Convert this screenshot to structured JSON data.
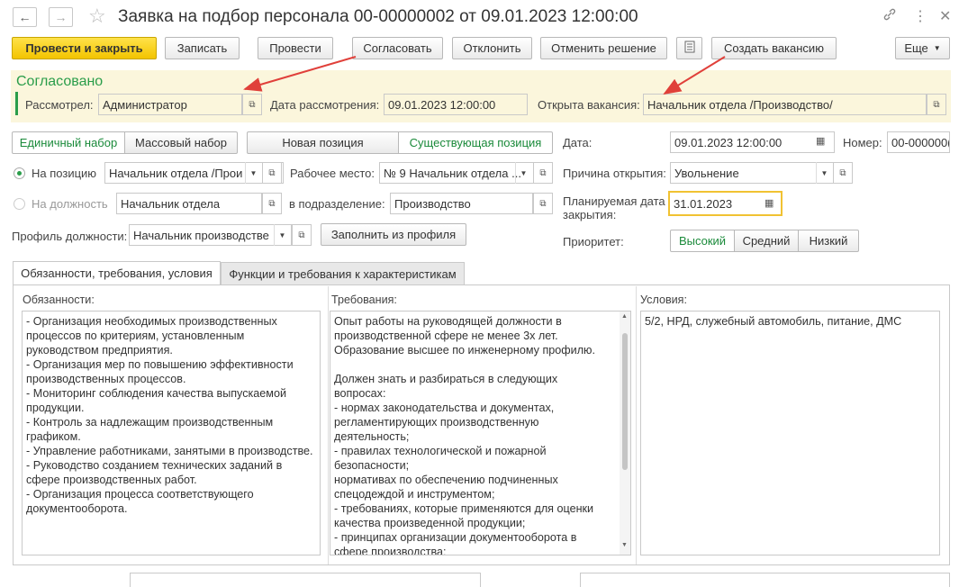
{
  "window": {
    "title": "Заявка на подбор персонала 00-00000002 от 09.01.2023 12:00:00",
    "back_icon": "arrow-left-icon",
    "forward_icon": "arrow-right-icon",
    "star_icon": "star-icon",
    "link_icon": "link-icon",
    "more_icon": "more-vertical-icon",
    "close_icon": "close-icon"
  },
  "toolbar": {
    "post_close": "Провести и закрыть",
    "save": "Записать",
    "post": "Провести",
    "approve": "Согласовать",
    "reject": "Отклонить",
    "cancel_decision": "Отменить решение",
    "create_vacancy": "Создать вакансию",
    "more": "Еще"
  },
  "status": {
    "label": "Согласовано",
    "reviewed_by_label": "Рассмотрел:",
    "reviewed_by": "Администратор",
    "review_date_label": "Дата рассмотрения:",
    "review_date": "09.01.2023 12:00:00",
    "vacancy_label": "Открыта вакансия:",
    "vacancy": "Начальник отдела /Производство/"
  },
  "form": {
    "selection_single": "Единичный набор",
    "selection_mass": "Массовый набор",
    "pos_new": "Новая позиция",
    "pos_existing": "Существующая позиция",
    "on_position_label": "На позицию",
    "on_position": "Начальник отдела /Прои",
    "workplace_label": "Рабочее место:",
    "workplace": "№ 9 Начальник отдела ...",
    "on_job_label": "На должность",
    "on_job": "Начальник отдела",
    "in_dept_label": "в подразделение:",
    "in_dept": "Производство",
    "profile_label": "Профиль должности:",
    "profile": "Начальник производстве",
    "fill_from_profile": "Заполнить из профиля",
    "date_label": "Дата:",
    "date": "09.01.2023 12:00:00",
    "number_label": "Номер:",
    "number": "00-000000(",
    "reason_label": "Причина открытия:",
    "reason": "Увольнение",
    "plan_close_label_1": "Планируемая дата",
    "plan_close_label_2": "закрытия:",
    "plan_close": "31.01.2023",
    "priority_label": "Приоритет:",
    "priority_high": "Высокий",
    "priority_medium": "Средний",
    "priority_low": "Низкий"
  },
  "tabs": {
    "tab1": "Обязанности, требования, условия",
    "tab2": "Функции и требования к характеристикам"
  },
  "details": {
    "duties_label": "Обязанности:",
    "duties": "- Организация необходимых производственных\nпроцессов по критериям, установленным\nруководством предприятия.\n- Организация мер по повышению эффективности\nпроизводственных процессов.\n- Мониторинг соблюдения качества выпускаемой\nпродукции.\n- Контроль за надлежащим производственным\nграфиком.\n- Управление работниками, занятыми в производстве.\n- Руководство созданием технических заданий в\nсфере производственных работ.\n- Организация процесса соответствующего\nдокументооборота.",
    "req_label": "Требования:",
    "requirements": "Опыт работы на руководящей должности в\nпроизводственной сфере не менее 3х лет.\nОбразование высшее по инженерному профилю.\n\nДолжен знать и разбираться в следующих\nвопросах:\n- нормах законодательства и документах,\nрегламентирующих производственную\nдеятельность;\n- правилах технологической и пожарной\nбезопасности;\nнормативах по обеспечению подчиненных\nспецодеждой и инструментом;\n- требованиях, которые применяются для оценки\nкачества произведенной продукции;\n- принципах организации документооборота в\nсфере производства;",
    "cond_label": "Условия:",
    "conditions": "5/2, НРД, служебный автомобиль, питание, ДМС"
  }
}
